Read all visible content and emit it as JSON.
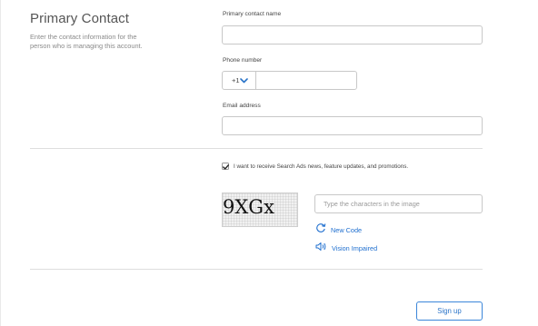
{
  "section": {
    "title": "Primary Contact",
    "description": "Enter the contact information for the person who is managing this account."
  },
  "contact_name": {
    "label": "Primary contact name",
    "value": ""
  },
  "phone": {
    "label": "Phone number",
    "country_code": "+1",
    "value": ""
  },
  "email": {
    "label": "Email address",
    "value": ""
  },
  "newsletter": {
    "checked": true,
    "label": "I want to receive Search Ads news, feature updates, and promotions."
  },
  "captcha": {
    "text": "9XGx",
    "input_placeholder": "Type the characters in the image",
    "new_code_label": "New Code",
    "vision_impaired_label": "Vision Impaired"
  },
  "signup_button": "Sign up",
  "colors": {
    "link": "#1f6fcf",
    "button_border": "#3b86d9",
    "border": "#c8c8c8"
  },
  "icons": {
    "select_caret": "chevron-down-icon",
    "new_code": "refresh-icon",
    "vision_impaired": "speaker-icon",
    "checkbox": "checkmark-icon"
  }
}
